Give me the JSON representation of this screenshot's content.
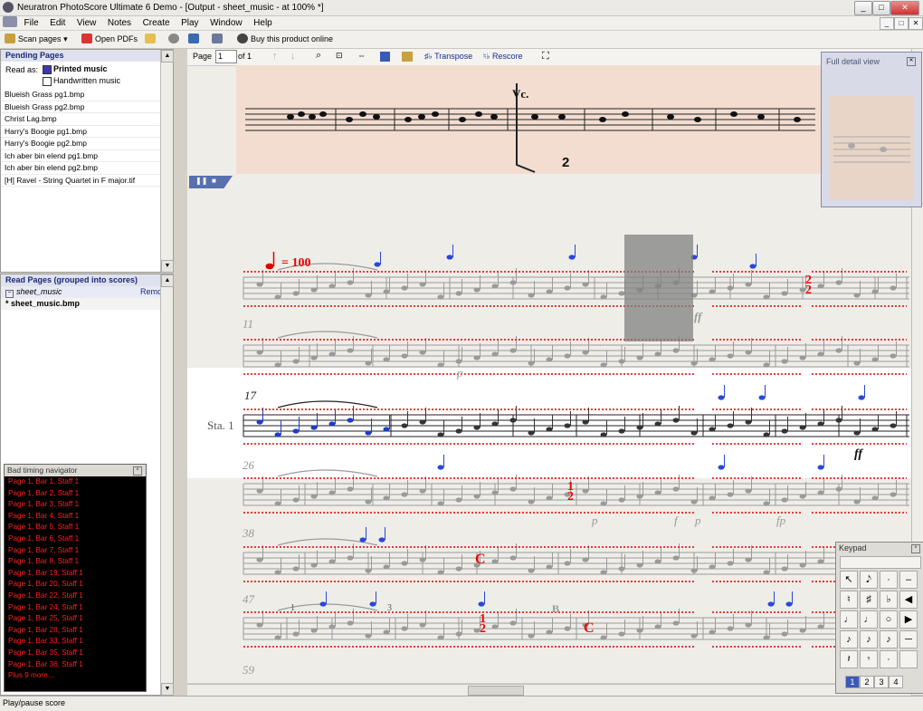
{
  "window": {
    "title": "Neuratron PhotoScore Ultimate 6 Demo - [Output - sheet_music - at 100% *]",
    "min": "_",
    "max": "□",
    "close": "✕"
  },
  "menu": [
    "File",
    "Edit",
    "View",
    "Notes",
    "Create",
    "Play",
    "Window",
    "Help"
  ],
  "mdi_buttons": [
    "_",
    "□",
    "✕"
  ],
  "toolbar": {
    "scan_pages": "Scan pages",
    "scan_arrow": "▾",
    "open_pdfs": "Open PDFs",
    "buy": "Buy this product online",
    "page_label": "Page",
    "page_value": "1",
    "page_of": "of 1",
    "transpose": "Transpose",
    "rescore": "Rescore"
  },
  "pending": {
    "header": "Pending Pages",
    "read_as": "Read as:",
    "printed": "Printed music",
    "handwritten": "Handwritten music",
    "files": [
      "Blueish Grass pg1.bmp",
      "Blueish Grass pg2.bmp",
      "Christ Lag.bmp",
      "Harry's Boogie pg1.bmp",
      "Harry's Boogie pg2.bmp",
      "Ich aber bin elend pg1.bmp",
      "Ich aber bin elend pg2.bmp",
      "[H] Ravel - String Quartet in F major.tif"
    ]
  },
  "read_pages": {
    "header": "Read Pages (grouped into scores)",
    "score_name": "sheet_music",
    "remove": "Remove",
    "file": "* sheet_music.bmp"
  },
  "bad_timing": {
    "header": "Bad timing navigator",
    "rows": [
      "Page 1, Bar 1, Staff 1",
      "Page 1, Bar 2, Staff 1",
      "Page 1, Bar 3, Staff 1",
      "Page 1, Bar 4, Staff 1",
      "Page 1, Bar 5, Staff 1",
      "Page 1, Bar 6, Staff 1",
      "Page 1, Bar 7, Staff 1",
      "Page 1, Bar 8, Staff 1",
      "Page 1, Bar 19, Staff 1",
      "Page 1, Bar 20, Staff 1",
      "Page 1, Bar 22, Staff 1",
      "Page 1, Bar 24, Staff 1",
      "Page 1, Bar 25, Staff 1",
      "Page 1, Bar 28, Staff 1",
      "Page 1, Bar 33, Staff 1",
      "Page 1, Bar 35, Staff 1",
      "Page 1, Bar 36, Staff 1",
      "Plus 9 more..."
    ]
  },
  "score": {
    "tempo": "= 100",
    "staff_label": "Sta. 1",
    "bar_numbers": [
      "11",
      "17",
      "26",
      "38",
      "47",
      "59"
    ],
    "original_header": "Vc.",
    "original_num": "2",
    "dyn_ff": "ff",
    "dyn_p": "p",
    "dyn_f": "f",
    "dyn_fp": "fp",
    "dyn_ff2": "ff",
    "rehearsal_b": "B",
    "time_c": "C",
    "time_12": "1",
    "time_12b": "2",
    "triplet_1": "1",
    "triplet_3": "3"
  },
  "detail": {
    "title": "Full detail view",
    "close": "✕"
  },
  "keypad": {
    "title": "Keypad",
    "pages": [
      "1",
      "2",
      "3",
      "4"
    ]
  },
  "status": "Play/pause score",
  "colors": {
    "accent": "#1a2a7a",
    "bad_text": "#ff2020",
    "note_blue": "#1e3cc8",
    "red_mark": "#e00000"
  }
}
